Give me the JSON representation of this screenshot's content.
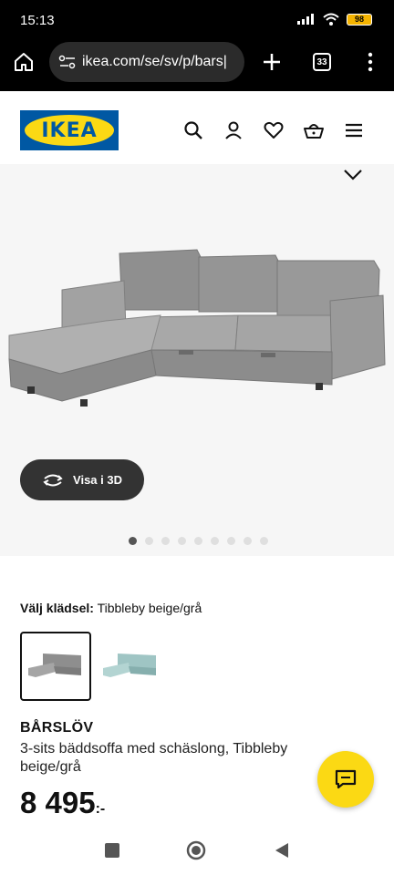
{
  "status_bar": {
    "time": "15:13",
    "battery": "98"
  },
  "browser": {
    "url": "ikea.com/se/sv/p/bars|",
    "tab_count": "33"
  },
  "header": {
    "logo_text": "IKEA"
  },
  "gallery": {
    "view_3d_label": "Visa i 3D",
    "image_count": 9,
    "active_image_index": 1
  },
  "fabric": {
    "label": "Välj klädsel:",
    "selected_value": "Tibbleby beige/grå"
  },
  "product": {
    "name": "BÅRSLÖV",
    "description": "3-sits bäddsoffa med schäslong, Tibbleby beige/grå",
    "price": "8 495",
    "currency_suffix": ":-"
  },
  "colors": {
    "ikea_blue": "#0058a3",
    "ikea_yellow": "#fbd914",
    "sofa_grey": "#8e8e8e",
    "sofa_blue": "#9fc5c4"
  },
  "icons": [
    "home-icon",
    "site-settings-icon",
    "new-tab-icon",
    "tabs-icon",
    "menu-dots-icon",
    "search-icon",
    "profile-icon",
    "heart-icon",
    "basket-icon",
    "hamburger-icon",
    "chevron-down-icon",
    "rotate-3d-icon",
    "chat-icon"
  ]
}
